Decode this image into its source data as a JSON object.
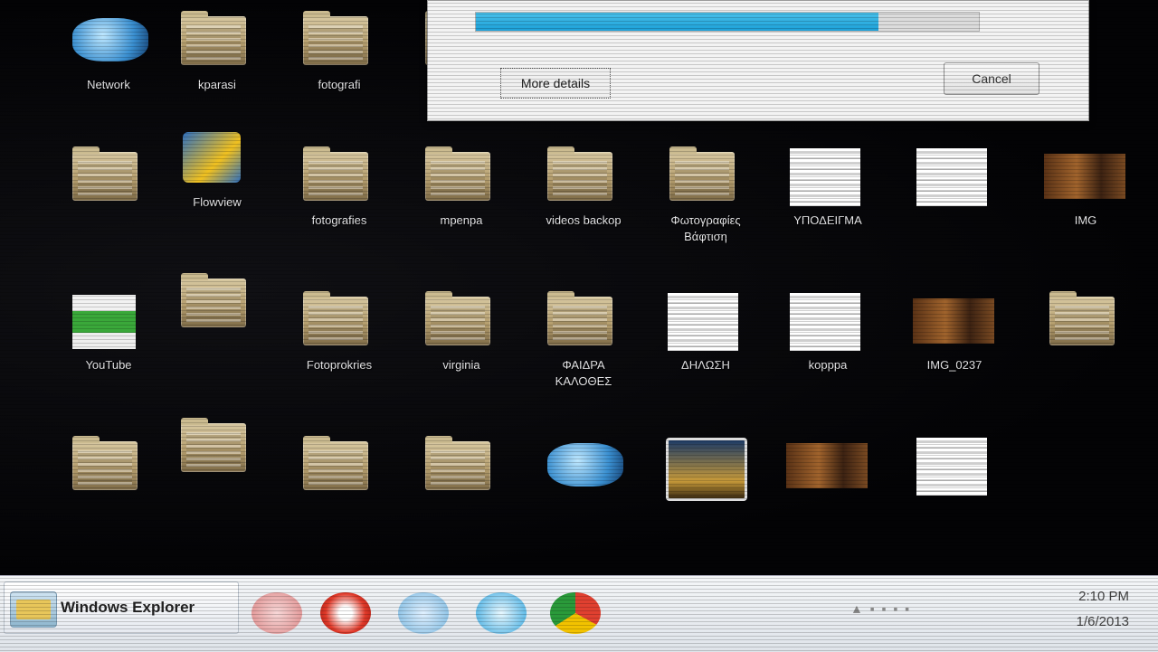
{
  "desktop": {
    "icons": [
      {
        "label": "Network",
        "kind": "globe"
      },
      {
        "label": "kparasi",
        "kind": "folder"
      },
      {
        "label": "fotografi",
        "kind": "folder"
      },
      {
        "label": "",
        "kind": "folder"
      },
      {
        "label": "",
        "kind": "folder"
      },
      {
        "label": "Flowview",
        "kind": "vlc"
      },
      {
        "label": "fotografies",
        "kind": "folder"
      },
      {
        "label": "mpenpa",
        "kind": "folder"
      },
      {
        "label": "videos backop",
        "kind": "folder"
      },
      {
        "label": "Φωτογραφίες",
        "label2": "Βάφτιση",
        "kind": "folder"
      },
      {
        "label": "ΥΠΟΔΕΙΓΜΑ",
        "kind": "doc"
      },
      {
        "label": "",
        "kind": "doc"
      },
      {
        "label": "IMG",
        "kind": "photo"
      },
      {
        "label": "YouTube",
        "kind": "green"
      },
      {
        "label": "",
        "kind": "folder"
      },
      {
        "label": "Fotoprokries",
        "kind": "folder"
      },
      {
        "label": "virginia",
        "kind": "folder"
      },
      {
        "label": "ΦΑΙΔΡΑ",
        "label2": "ΚΑΛΟΘΕΣ",
        "kind": "folder"
      },
      {
        "label": "ΔΗΛΩΣΗ",
        "kind": "doc"
      },
      {
        "label": "kopppa",
        "kind": "doc"
      },
      {
        "label": "IMG_0237",
        "kind": "photo"
      },
      {
        "label": "",
        "kind": "folder"
      },
      {
        "label": "",
        "kind": "folder"
      },
      {
        "label": "",
        "kind": "folder"
      },
      {
        "label": "",
        "kind": "folder"
      },
      {
        "label": "",
        "kind": "folder"
      },
      {
        "label": "",
        "kind": "globe"
      },
      {
        "label": "",
        "kind": "media"
      },
      {
        "label": "",
        "kind": "photo"
      },
      {
        "label": "",
        "kind": "doc"
      }
    ]
  },
  "dialog": {
    "progress": 0.8,
    "more_details": "More details",
    "cancel": "Cancel"
  },
  "taskbar": {
    "explorer_label": "Windows Explorer",
    "pinned": [
      "paint-icon",
      "opera-icon",
      "media-icon",
      "skype-icon",
      "chrome-icon"
    ],
    "time": "2:10 PM",
    "date": "1/6/2013"
  },
  "colors": {
    "progress": "#1ca0d8",
    "desktop_bg": "#050507",
    "taskbar": "#e8ecf0"
  }
}
